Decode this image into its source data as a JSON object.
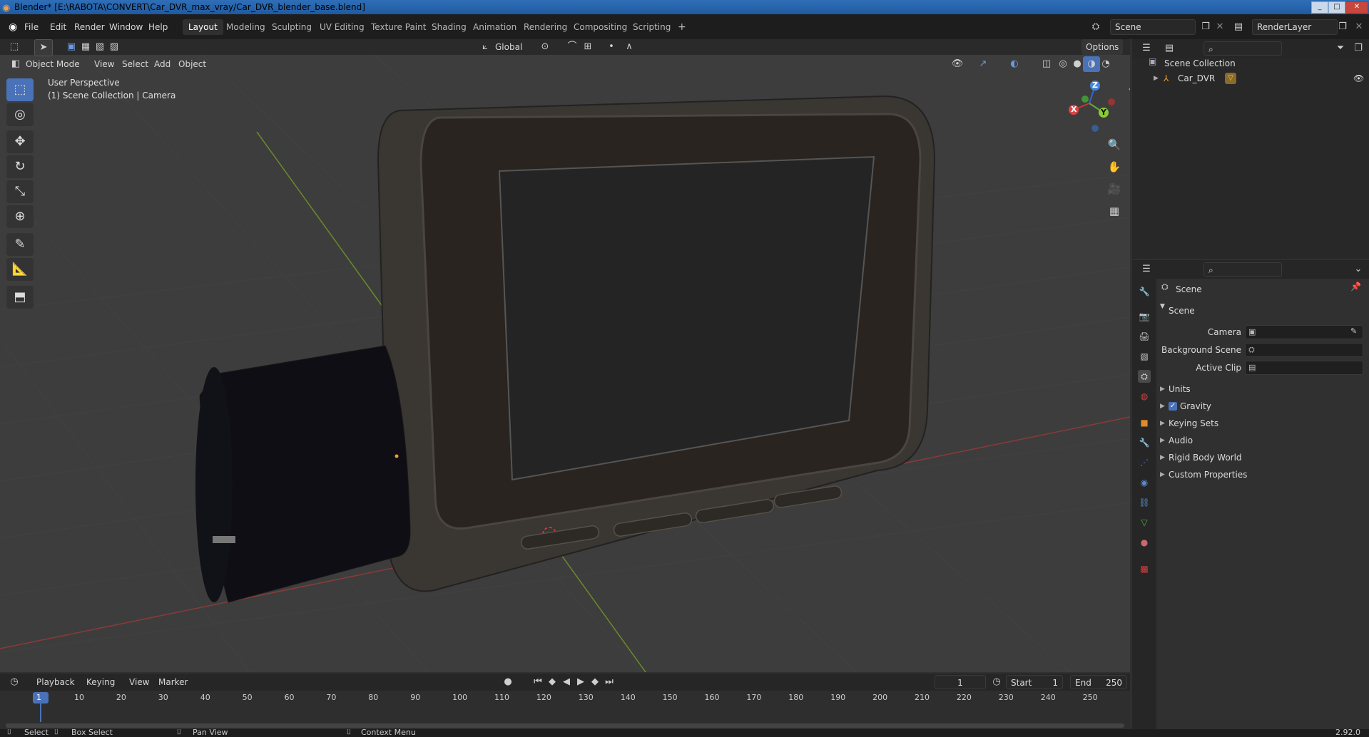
{
  "titlebar": {
    "title": "Blender* [E:\\RABOTA\\CONVERT\\Car_DVR_max_vray/Car_DVR_blender_base.blend]",
    "minimize": "_",
    "maximize": "□",
    "close": "✕"
  },
  "menus": [
    "File",
    "Edit",
    "Render",
    "Window",
    "Help"
  ],
  "workspaces": [
    "Layout",
    "Modeling",
    "Sculpting",
    "UV Editing",
    "Texture Paint",
    "Shading",
    "Animation",
    "Rendering",
    "Compositing",
    "Scripting"
  ],
  "add_workspace": "+",
  "scene_field": "Scene",
  "renderlayer_field": "RenderLayer",
  "viewport_header": {
    "mode": "Object Mode",
    "menus": [
      "View",
      "Select",
      "Add",
      "Object"
    ],
    "orientation": "Global",
    "options": "Options"
  },
  "viewport_overlay": {
    "perspective": "User Perspective",
    "collection": "(1) Scene Collection | Camera"
  },
  "gizmo": {
    "x": "X",
    "y": "Y",
    "z": "Z"
  },
  "outliner": {
    "root": "Scene Collection",
    "items": [
      {
        "label": "Car_DVR"
      }
    ]
  },
  "properties": {
    "header": "Scene",
    "section": "Scene",
    "fields": [
      {
        "label": "Camera"
      },
      {
        "label": "Background Scene"
      },
      {
        "label": "Active Clip"
      }
    ],
    "subpanels": [
      "Units",
      "Gravity",
      "Keying Sets",
      "Audio",
      "Rigid Body World",
      "Custom Properties"
    ]
  },
  "timeline": {
    "menus": [
      "Playback",
      "Keying",
      "View",
      "Marker"
    ],
    "current_frame": "1",
    "start_label": "Start",
    "start": "1",
    "end_label": "End",
    "end": "250",
    "ticks": [
      "1",
      "10",
      "20",
      "30",
      "40",
      "50",
      "60",
      "70",
      "80",
      "90",
      "100",
      "110",
      "120",
      "130",
      "140",
      "150",
      "160",
      "170",
      "180",
      "190",
      "200",
      "210",
      "220",
      "230",
      "240",
      "250"
    ]
  },
  "statusbar": {
    "items": [
      "Select",
      "Box Select",
      "Pan View",
      "Context Menu"
    ],
    "version": "2.92.0"
  }
}
